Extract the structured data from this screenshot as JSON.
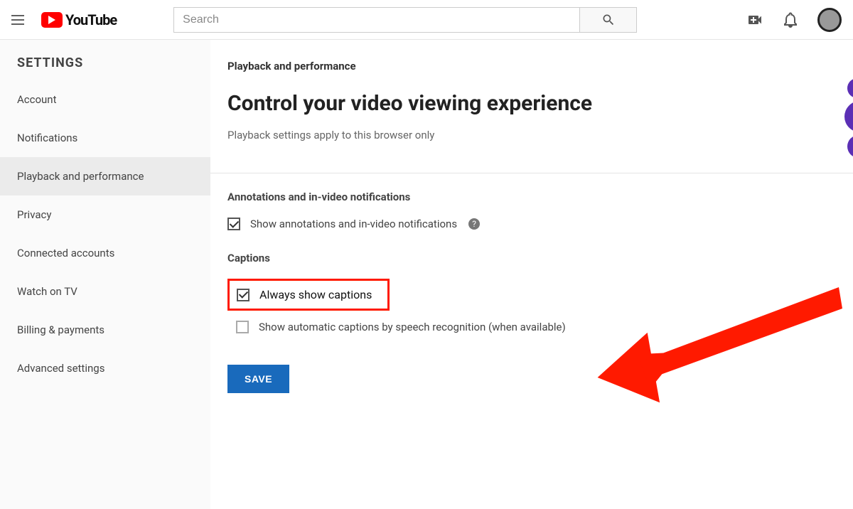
{
  "header": {
    "brand": "YouTube",
    "search_placeholder": "Search"
  },
  "sidebar": {
    "title": "SETTINGS",
    "items": [
      {
        "label": "Account"
      },
      {
        "label": "Notifications"
      },
      {
        "label": "Playback and performance",
        "active": true
      },
      {
        "label": "Privacy"
      },
      {
        "label": "Connected accounts"
      },
      {
        "label": "Watch on TV"
      },
      {
        "label": "Billing & payments"
      },
      {
        "label": "Advanced settings"
      }
    ]
  },
  "main": {
    "section_label": "Playback and performance",
    "heading": "Control your video viewing experience",
    "subtext": "Playback settings apply to this browser only",
    "annotations": {
      "title": "Annotations and in-video notifications",
      "option": {
        "label": "Show annotations and in-video notifications",
        "checked": true
      }
    },
    "captions": {
      "title": "Captions",
      "always": {
        "label": "Always show captions",
        "checked": true,
        "highlighted": true
      },
      "auto": {
        "label": "Show automatic captions by speech recognition (when available)",
        "checked": false
      }
    },
    "save_label": "SAVE"
  },
  "colors": {
    "accent_red": "#ff1a00",
    "primary_blue": "#196abc"
  }
}
